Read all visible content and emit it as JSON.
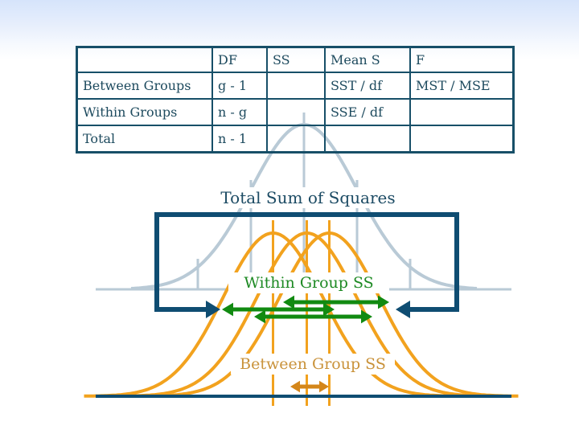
{
  "table": {
    "headers": [
      "",
      "DF",
      "SS",
      "Mean S",
      "F"
    ],
    "rows": [
      {
        "label": "Between Groups",
        "df": "g - 1",
        "ss": "",
        "ms": "SST / df",
        "f": "MST / MSE"
      },
      {
        "label": "Within Groups",
        "df": "n - g",
        "ss": "",
        "ms": "SSE / df",
        "f": ""
      },
      {
        "label": "Total",
        "df": "n - 1",
        "ss": "",
        "ms": "",
        "f": ""
      }
    ]
  },
  "diagram": {
    "total_label": "Total Sum of Squares",
    "within_label": "Within Group SS",
    "between_label": "Between Group SS",
    "overall_distribution": {
      "description": "pooled normal curve",
      "mean": 0,
      "sd_marks": [
        -2,
        -1,
        0,
        1,
        2
      ]
    },
    "group_distributions": [
      {
        "name": "group-1",
        "mean": -0.55
      },
      {
        "name": "group-2",
        "mean": 0.05
      },
      {
        "name": "group-3",
        "mean": 0.45
      }
    ]
  },
  "colors": {
    "table_border": "#174f68",
    "text": "#1d4a5e",
    "total_box": "#0f4d72",
    "overall_curve": "#b9cad6",
    "group_curves": "#f2a21e",
    "within_arrows": "#118a11",
    "between_arrow": "#d4861a",
    "baseline": "#0f4d72"
  }
}
